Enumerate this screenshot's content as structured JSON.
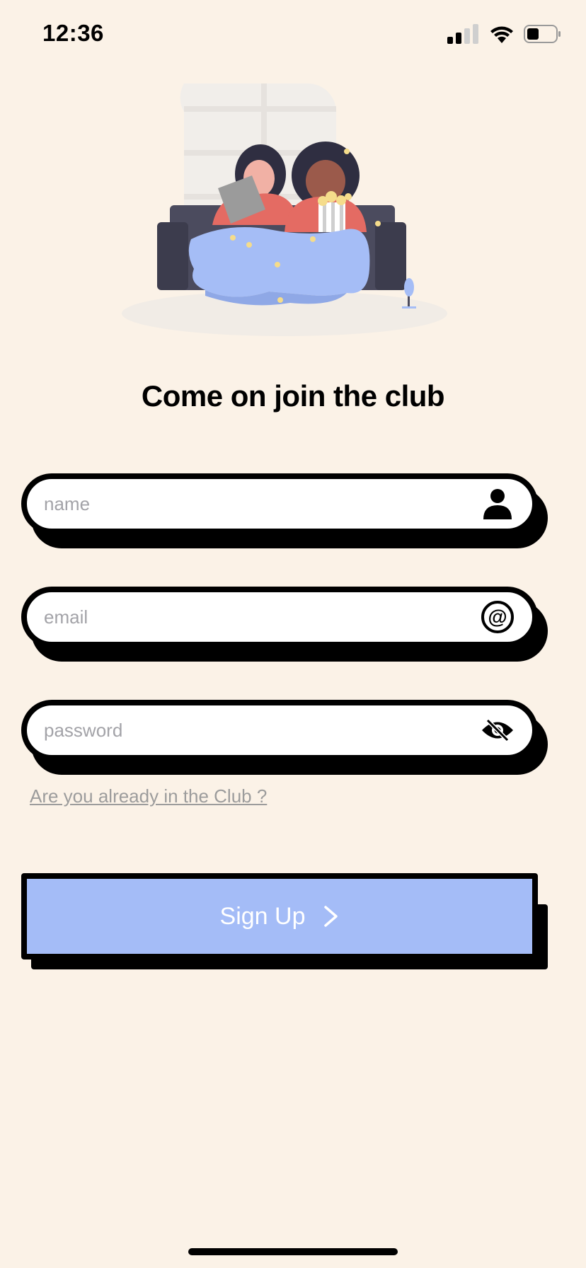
{
  "status_bar": {
    "time": "12:36"
  },
  "headline": "Come on join the club",
  "form": {
    "name_placeholder": "name",
    "email_placeholder": "email",
    "password_placeholder": "password",
    "login_link": "Are you already in the Club ?",
    "submit_label": "Sign Up"
  },
  "icons": {
    "name": "person-icon",
    "email": "at-sign-icon",
    "password": "eye-slash-icon",
    "submit": "chevron-right-icon"
  },
  "colors": {
    "background": "#fbf2e7",
    "button": "#a4bcf7",
    "border": "#000000",
    "placeholder": "#a3a3a8"
  }
}
